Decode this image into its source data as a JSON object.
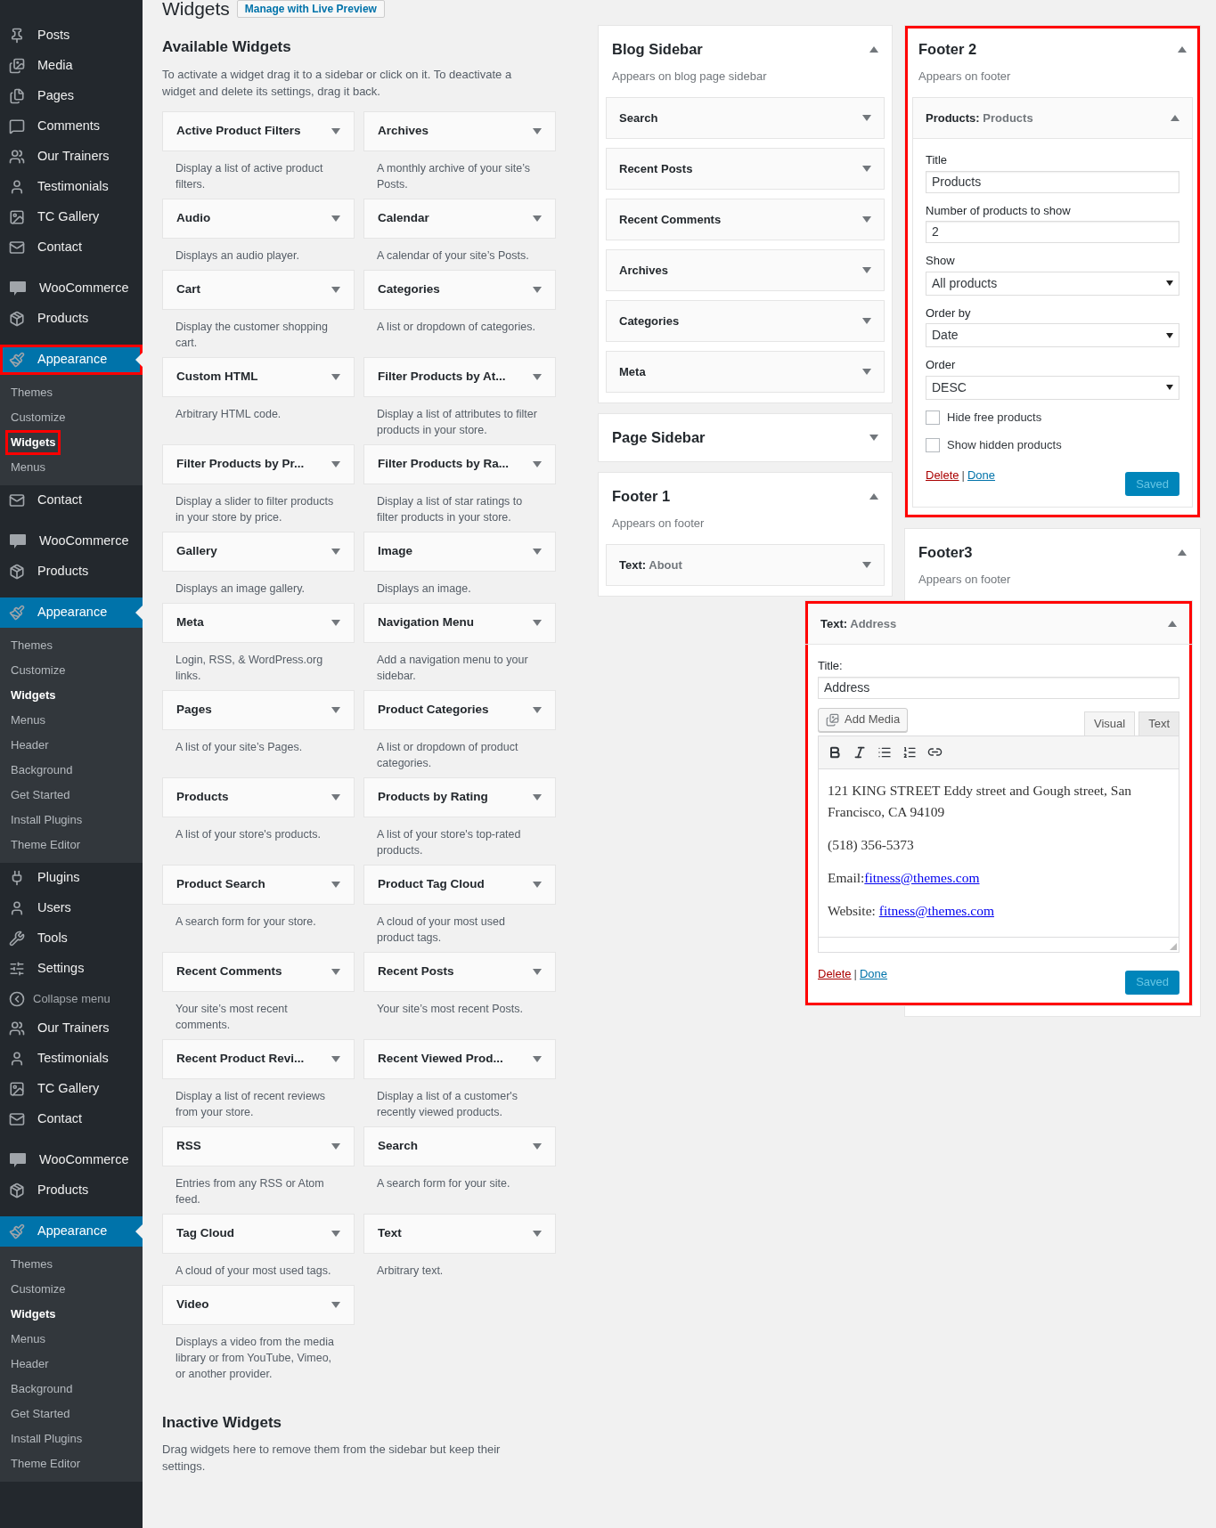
{
  "page": {
    "title": "Widgets",
    "action": "Manage with Live Preview"
  },
  "admin_menu": [
    {
      "items": [
        {
          "kind": "menu",
          "label": "Posts",
          "selected": false,
          "highlighted": false
        },
        {
          "kind": "menu",
          "label": "Media",
          "selected": false,
          "highlighted": false
        },
        {
          "kind": "menu",
          "label": "Pages",
          "selected": false,
          "highlighted": false
        },
        {
          "kind": "menu",
          "label": "Comments",
          "selected": false,
          "highlighted": false
        },
        {
          "kind": "menu",
          "label": "Our Trainers",
          "selected": false,
          "highlighted": false
        },
        {
          "kind": "menu",
          "label": "Testimonials",
          "selected": false,
          "highlighted": false
        },
        {
          "kind": "menu",
          "label": "TC Gallery",
          "selected": false,
          "highlighted": false
        },
        {
          "kind": "menu",
          "label": "Contact",
          "selected": false,
          "highlighted": false
        }
      ]
    },
    {
      "items": [
        {
          "kind": "menu",
          "label": "WooCommerce",
          "selected": false,
          "highlighted": false
        },
        {
          "kind": "menu",
          "label": "Products",
          "selected": false,
          "highlighted": false
        }
      ]
    },
    {
      "items": [
        {
          "kind": "menu",
          "label": "Appearance",
          "selected": true,
          "highlighted": true,
          "children": [
            {
              "label": "Themes",
              "selected": false,
              "highlighted": false
            },
            {
              "label": "Customize",
              "selected": false,
              "highlighted": false
            },
            {
              "label": "Widgets",
              "selected": true,
              "highlighted": true
            },
            {
              "label": "Menus",
              "selected": false,
              "highlighted": false
            }
          ]
        },
        {
          "kind": "menu",
          "label": "Contact",
          "selected": false,
          "highlighted": false
        }
      ]
    },
    {
      "items": [
        {
          "kind": "menu",
          "label": "WooCommerce",
          "selected": false,
          "highlighted": false
        },
        {
          "kind": "menu",
          "label": "Products",
          "selected": false,
          "highlighted": false
        }
      ]
    },
    {
      "items": [
        {
          "kind": "menu",
          "label": "Appearance",
          "selected": true,
          "highlighted": false,
          "children": [
            {
              "label": "Themes",
              "selected": false,
              "highlighted": false
            },
            {
              "label": "Customize",
              "selected": false,
              "highlighted": false
            },
            {
              "label": "Widgets",
              "selected": true,
              "highlighted": false
            },
            {
              "label": "Menus",
              "selected": false,
              "highlighted": false
            },
            {
              "label": "Header",
              "selected": false,
              "highlighted": false
            },
            {
              "label": "Background",
              "selected": false,
              "highlighted": false
            },
            {
              "label": "Get Started",
              "selected": false,
              "highlighted": false
            },
            {
              "label": "Install Plugins",
              "selected": false,
              "highlighted": false
            },
            {
              "label": "Theme Editor",
              "selected": false,
              "highlighted": false
            }
          ]
        },
        {
          "kind": "menu",
          "label": "Plugins",
          "selected": false,
          "highlighted": false
        },
        {
          "kind": "menu",
          "label": "Users",
          "selected": false,
          "highlighted": false
        },
        {
          "kind": "menu",
          "label": "Tools",
          "selected": false,
          "highlighted": false
        },
        {
          "kind": "menu",
          "label": "Settings",
          "selected": false,
          "highlighted": false
        },
        {
          "kind": "collapse",
          "label": "Collapse menu",
          "selected": false,
          "highlighted": false
        },
        {
          "kind": "menu",
          "label": "Our Trainers",
          "selected": false,
          "highlighted": false
        },
        {
          "kind": "menu",
          "label": "Testimonials",
          "selected": false,
          "highlighted": false
        },
        {
          "kind": "menu",
          "label": "TC Gallery",
          "selected": false,
          "highlighted": false
        },
        {
          "kind": "menu",
          "label": "Contact",
          "selected": false,
          "highlighted": false
        }
      ]
    },
    {
      "items": [
        {
          "kind": "menu",
          "label": "WooCommerce",
          "selected": false,
          "highlighted": false
        },
        {
          "kind": "menu",
          "label": "Products",
          "selected": false,
          "highlighted": false
        }
      ]
    },
    {
      "items": [
        {
          "kind": "menu",
          "label": "Appearance",
          "selected": true,
          "highlighted": false,
          "children": [
            {
              "label": "Themes",
              "selected": false,
              "highlighted": false
            },
            {
              "label": "Customize",
              "selected": false,
              "highlighted": false
            },
            {
              "label": "Widgets",
              "selected": true,
              "highlighted": false
            },
            {
              "label": "Menus",
              "selected": false,
              "highlighted": false
            },
            {
              "label": "Header",
              "selected": false,
              "highlighted": false
            },
            {
              "label": "Background",
              "selected": false,
              "highlighted": false
            },
            {
              "label": "Get Started",
              "selected": false,
              "highlighted": false
            },
            {
              "label": "Install Plugins",
              "selected": false,
              "highlighted": false
            },
            {
              "label": "Theme Editor",
              "selected": false,
              "highlighted": false
            }
          ]
        }
      ]
    }
  ],
  "available_widgets": {
    "title": "Available Widgets",
    "description": "To activate a widget drag it to a sidebar or click on it. To deactivate a widget and delete its settings, drag it back.",
    "widgets": [
      {
        "name": "Active Product Filters",
        "description": "Display a list of active product filters."
      },
      {
        "name": "Archives",
        "description": "A monthly archive of your site’s Posts."
      },
      {
        "name": "Audio",
        "description": "Displays an audio player."
      },
      {
        "name": "Calendar",
        "description": "A calendar of your site’s Posts."
      },
      {
        "name": "Cart",
        "description": "Display the customer shopping cart."
      },
      {
        "name": "Categories",
        "description": "A list or dropdown of categories."
      },
      {
        "name": "Custom HTML",
        "description": "Arbitrary HTML code."
      },
      {
        "name": "Filter Products by At...",
        "description": "Display a list of attributes to filter products in your store."
      },
      {
        "name": "Filter Products by Pr...",
        "description": "Display a slider to filter products in your store by price."
      },
      {
        "name": "Filter Products by Ra...",
        "description": "Display a list of star ratings to filter products in your store."
      },
      {
        "name": "Gallery",
        "description": "Displays an image gallery."
      },
      {
        "name": "Image",
        "description": "Displays an image."
      },
      {
        "name": "Meta",
        "description": "Login, RSS, & WordPress.org links."
      },
      {
        "name": "Navigation Menu",
        "description": "Add a navigation menu to your sidebar."
      },
      {
        "name": "Pages",
        "description": "A list of your site’s Pages."
      },
      {
        "name": "Product Categories",
        "description": "A list or dropdown of product categories."
      },
      {
        "name": "Products",
        "description": "A list of your store's products."
      },
      {
        "name": "Products by Rating",
        "description": "A list of your store's top-rated products."
      },
      {
        "name": "Product Search",
        "description": "A search form for your store."
      },
      {
        "name": "Product Tag Cloud",
        "description": "A cloud of your most used product tags."
      },
      {
        "name": "Recent Comments",
        "description": "Your site’s most recent comments."
      },
      {
        "name": "Recent Posts",
        "description": "Your site’s most recent Posts."
      },
      {
        "name": "Recent Product Revi...",
        "description": "Display a list of recent reviews from your store."
      },
      {
        "name": "Recent Viewed Prod...",
        "description": "Display a list of a customer's recently viewed products."
      },
      {
        "name": "RSS",
        "description": "Entries from any RSS or Atom feed."
      },
      {
        "name": "Search",
        "description": "A search form for your site."
      },
      {
        "name": "Tag Cloud",
        "description": "A cloud of your most used tags."
      },
      {
        "name": "Text",
        "description": "Arbitrary text."
      },
      {
        "name": "Video",
        "description": "Displays a video from the media library or from YouTube, Vimeo, or another provider."
      }
    ]
  },
  "inactive_widgets": {
    "title": "Inactive Widgets",
    "description": "Drag widgets here to remove them from the sidebar but keep their settings."
  },
  "sidebar_columns": [
    {
      "areas": [
        {
          "title": "Blog Sidebar",
          "description": "Appears on blog page sidebar",
          "expanded": true,
          "highlighted": false,
          "widgets": [
            {
              "name": "Search",
              "expanded": false,
              "highlighted": false
            },
            {
              "name": "Recent Posts",
              "expanded": false,
              "highlighted": false
            },
            {
              "name": "Recent Comments",
              "expanded": false,
              "highlighted": false
            },
            {
              "name": "Archives",
              "expanded": false,
              "highlighted": false
            },
            {
              "name": "Categories",
              "expanded": false,
              "highlighted": false
            },
            {
              "name": "Meta",
              "expanded": false,
              "highlighted": false
            }
          ]
        },
        {
          "title": "Page Sidebar",
          "expanded": false,
          "highlighted": false
        },
        {
          "title": "Footer 1",
          "description": "Appears on footer",
          "expanded": true,
          "highlighted": false,
          "widgets": [
            {
              "name": "Text:",
              "title": "About",
              "expanded": false,
              "highlighted": false
            }
          ]
        }
      ]
    },
    {
      "areas": [
        {
          "title": "Footer 2",
          "description": "Appears on footer",
          "expanded": true,
          "highlighted": true,
          "widgets": [
            {
              "name": "Products:",
              "title": "Products",
              "expanded": true,
              "highlighted": false,
              "wide": false,
              "fields": [
                {
                  "kind": "text",
                  "label": "Title",
                  "value": "Products"
                },
                {
                  "kind": "text",
                  "label": "Number of products to show",
                  "value": "2"
                },
                {
                  "kind": "select",
                  "label": "Show",
                  "value": "All products"
                },
                {
                  "kind": "select",
                  "label": "Order by",
                  "value": "Date"
                },
                {
                  "kind": "select",
                  "label": "Order",
                  "value": "DESC"
                },
                {
                  "kind": "checkbox",
                  "label": "Hide free products",
                  "checked": false
                },
                {
                  "kind": "checkbox",
                  "label": "Show hidden products",
                  "checked": false
                }
              ],
              "delete": "Delete",
              "separator": "|",
              "done": "Done",
              "save": "Saved"
            }
          ]
        },
        {
          "title": "Footer3",
          "description": "Appears on footer",
          "expanded": true,
          "highlighted": false,
          "widgets": [
            {
              "name": "Text:",
              "title": "Address",
              "expanded": true,
              "highlighted": true,
              "wide": true,
              "fields": [
                {
                  "kind": "text",
                  "label": "Title:",
                  "value": "Address"
                },
                {
                  "kind": "editor",
                  "add_media": "Add Media",
                  "tabs": [
                    {
                      "label": "Visual",
                      "selected": true
                    },
                    {
                      "label": "Text",
                      "selected": false
                    }
                  ],
                  "paragraphs": [
                    {
                      "text": "121 KING STREET Eddy street and Gough street, San Francisco, CA 94109"
                    },
                    {
                      "text": "(518) 356-5373"
                    },
                    {
                      "text": "Email:",
                      "link": "fitness@themes.com"
                    },
                    {
                      "text": "Website: ",
                      "link": "fitness@themes.com"
                    }
                  ]
                }
              ],
              "delete": "Delete",
              "separator": "|",
              "done": "Done",
              "save": "Saved"
            }
          ]
        }
      ]
    }
  ]
}
